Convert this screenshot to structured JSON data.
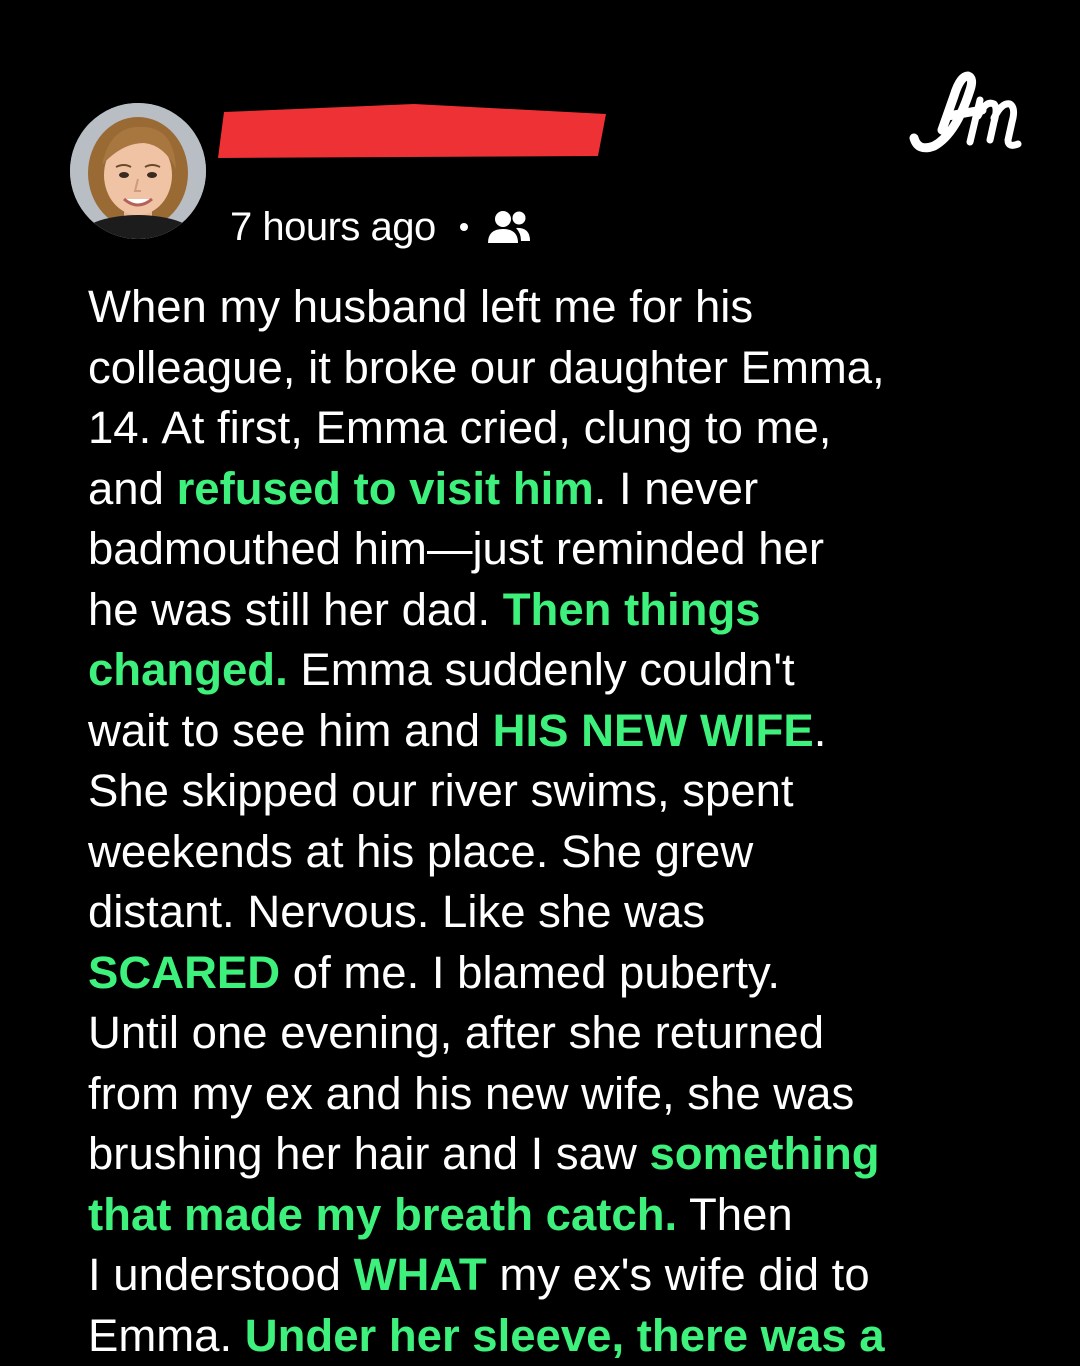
{
  "post": {
    "timestamp": "7 hours ago",
    "audience_icon": "friends-icon",
    "author_name_redacted": true,
    "lines": [
      [
        {
          "t": "When my husband left me for his",
          "hl": false
        }
      ],
      [
        {
          "t": "colleague, it broke our daughter Emma,",
          "hl": false
        }
      ],
      [
        {
          "t": "14. At first, Emma cried, clung to me,",
          "hl": false
        }
      ],
      [
        {
          "t": "and ",
          "hl": false
        },
        {
          "t": "refused to visit him",
          "hl": true
        },
        {
          "t": ". I never",
          "hl": false
        }
      ],
      [
        {
          "t": "badmouthed him—just reminded her",
          "hl": false
        }
      ],
      [
        {
          "t": "he was still her dad. ",
          "hl": false
        },
        {
          "t": "Then things",
          "hl": true
        }
      ],
      [
        {
          "t": "changed.",
          "hl": true
        },
        {
          "t": " Emma suddenly couldn't",
          "hl": false
        }
      ],
      [
        {
          "t": "wait to see him and ",
          "hl": false
        },
        {
          "t": "HIS NEW WIFE",
          "hl": true
        },
        {
          "t": ".",
          "hl": false
        }
      ],
      [
        {
          "t": "She skipped our river swims, spent",
          "hl": false
        }
      ],
      [
        {
          "t": "weekends at his place. She grew",
          "hl": false
        }
      ],
      [
        {
          "t": "distant. Nervous. Like she was",
          "hl": false
        }
      ],
      [
        {
          "t": "SCARED",
          "hl": true
        },
        {
          "t": " of me. I blamed puberty.",
          "hl": false
        }
      ],
      [
        {
          "t": "Until one evening, after she returned",
          "hl": false
        }
      ],
      [
        {
          "t": "from my ex and his new wife, she was",
          "hl": false
        }
      ],
      [
        {
          "t": "brushing her hair and I saw ",
          "hl": false
        },
        {
          "t": "something",
          "hl": true
        }
      ],
      [
        {
          "t": "that made my breath catch.",
          "hl": true
        },
        {
          "t": " Then",
          "hl": false
        }
      ],
      [
        {
          "t": "I understood ",
          "hl": false
        },
        {
          "t": "WHAT",
          "hl": true
        },
        {
          "t": " my ex's wife did to",
          "hl": false
        }
      ],
      [
        {
          "t": "Emma. ",
          "hl": false
        },
        {
          "t": "Under her sleeve, there was a",
          "hl": true
        }
      ]
    ]
  },
  "brand": {
    "logo_icon": "amomama-logo-icon",
    "logo_text": "Am"
  },
  "colors": {
    "background": "#000000",
    "text": "#ffffff",
    "highlight": "#3ef07c",
    "redaction": "#ee3135"
  }
}
